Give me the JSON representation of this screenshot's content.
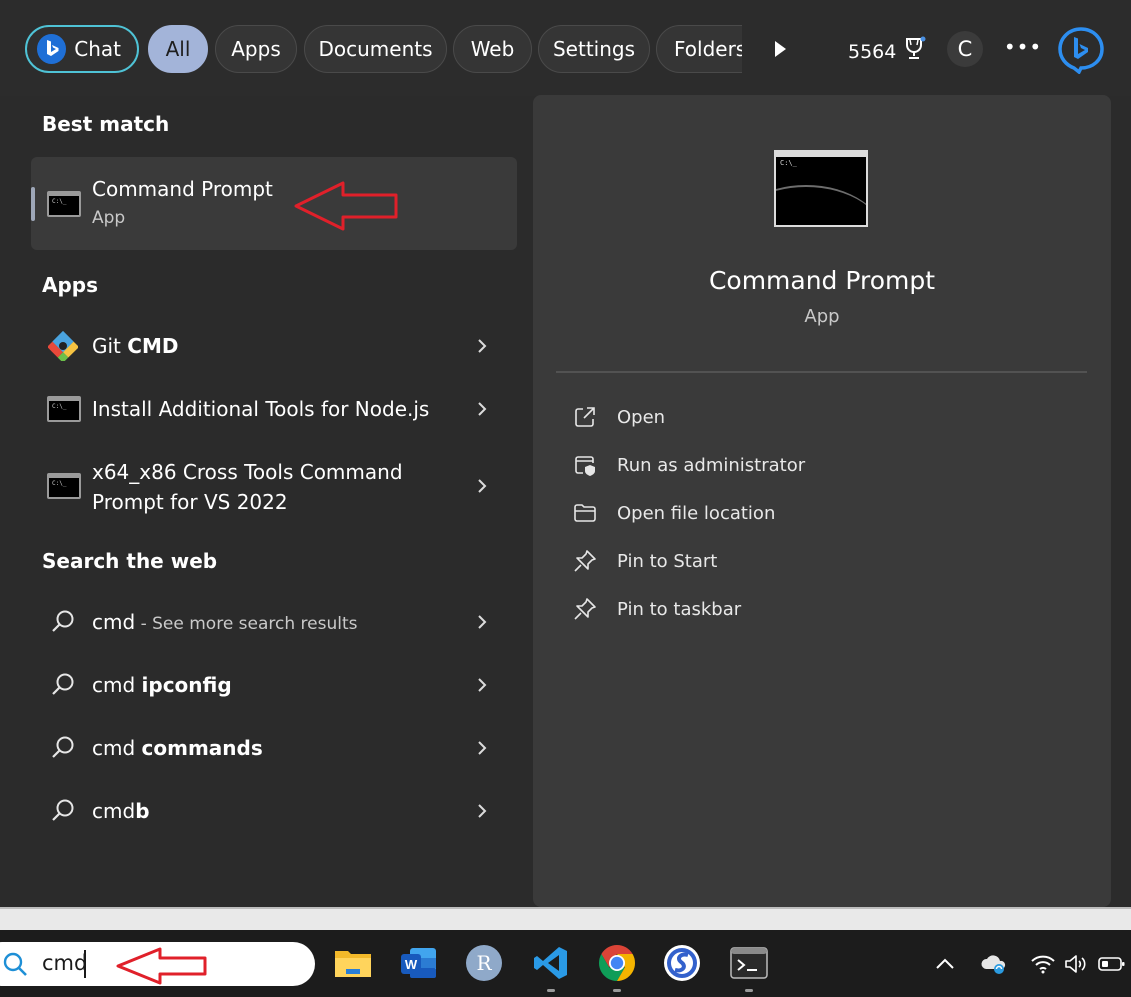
{
  "filters": {
    "chat": "Chat",
    "all": "All",
    "apps": "Apps",
    "documents": "Documents",
    "web": "Web",
    "settings": "Settings",
    "folders": "Folders"
  },
  "rewards_points": "5564",
  "profile_initial": "C",
  "more_label": "•••",
  "best_match": {
    "heading": "Best match",
    "title": "Command Prompt",
    "subtitle": "App"
  },
  "apps": {
    "heading": "Apps",
    "items": [
      {
        "prefix": "Git ",
        "bold": "CMD",
        "icon": "git-icon"
      },
      {
        "label": "Install Additional Tools for Node.js",
        "icon": "console-icon"
      },
      {
        "line1": "x64_x86 Cross Tools Command",
        "line2": "Prompt for VS 2022",
        "icon": "console-icon"
      }
    ]
  },
  "web": {
    "heading": "Search the web",
    "items": [
      {
        "prefix": "cmd",
        "suffix": " - See more search results"
      },
      {
        "prefix": "cmd ",
        "bold": "ipconfig"
      },
      {
        "prefix": "cmd ",
        "bold": "commands"
      },
      {
        "prefix": "cmd",
        "bold": "b"
      }
    ]
  },
  "preview": {
    "title": "Command Prompt",
    "subtitle": "App",
    "actions": [
      "Open",
      "Run as administrator",
      "Open file location",
      "Pin to Start",
      "Pin to taskbar"
    ]
  },
  "taskbar": {
    "search_text": "cmd",
    "apps": [
      "file-explorer",
      "word",
      "r",
      "vscode",
      "chrome",
      "simplenote",
      "terminal"
    ]
  },
  "colors": {
    "chat_border": "#4fc3d6",
    "all_pill": "#a3b4d9",
    "annotation_arrow": "#e0202a"
  }
}
